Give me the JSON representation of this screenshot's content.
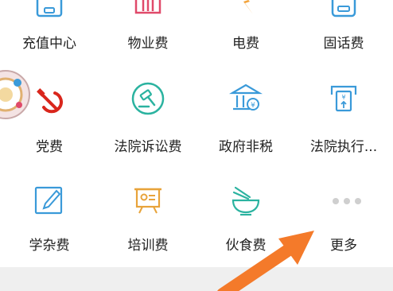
{
  "services": [
    {
      "label": "充值中心",
      "icon": "phone-recharge-icon"
    },
    {
      "label": "物业费",
      "icon": "property-fee-icon"
    },
    {
      "label": "电费",
      "icon": "lightning-icon"
    },
    {
      "label": "固话费",
      "icon": "landline-icon"
    },
    {
      "label": "党费",
      "icon": "hammer-sickle-icon"
    },
    {
      "label": "法院诉讼费",
      "icon": "gavel-icon"
    },
    {
      "label": "政府非税",
      "icon": "government-building-icon"
    },
    {
      "label": "法院执行...",
      "icon": "atm-icon"
    },
    {
      "label": "学杂费",
      "icon": "pencil-icon"
    },
    {
      "label": "培训费",
      "icon": "presentation-board-icon"
    },
    {
      "label": "伙食费",
      "icon": "food-bowl-icon"
    },
    {
      "label": "更多",
      "icon": "more-dots-icon"
    }
  ],
  "colors": {
    "blue": "#3a9ad9",
    "pink": "#e04a6a",
    "orange": "#f3a33a",
    "teal": "#2bb3a0",
    "red": "#d9261c",
    "gold": "#e8a33a",
    "arrow": "#f47a2a"
  }
}
